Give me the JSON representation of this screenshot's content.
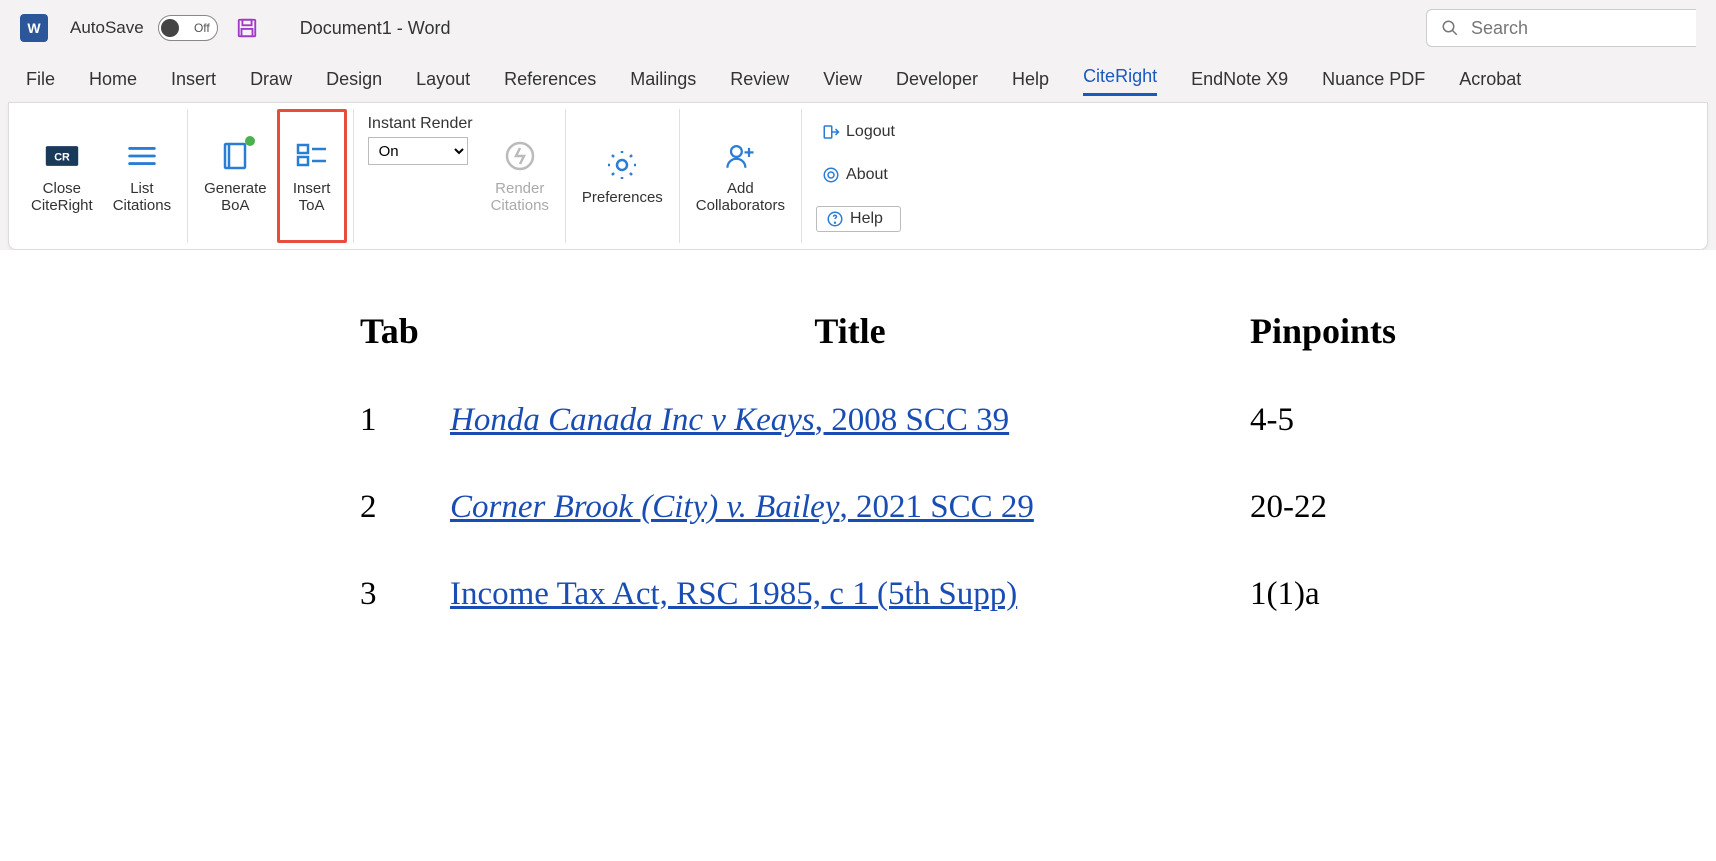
{
  "titlebar": {
    "autosave_label": "AutoSave",
    "autosave_state": "Off",
    "doc_title": "Document1  -  Word",
    "search_placeholder": "Search"
  },
  "menubar": {
    "items": [
      "File",
      "Home",
      "Insert",
      "Draw",
      "Design",
      "Layout",
      "References",
      "Mailings",
      "Review",
      "View",
      "Developer",
      "Help",
      "CiteRight",
      "EndNote X9",
      "Nuance PDF",
      "Acrobat"
    ],
    "active": "CiteRight"
  },
  "ribbon": {
    "close_label_l1": "Close",
    "close_label_l2": "CiteRight",
    "list_label_l1": "List",
    "list_label_l2": "Citations",
    "gen_label_l1": "Generate",
    "gen_label_l2": "BoA",
    "insert_label_l1": "Insert",
    "insert_label_l2": "ToA",
    "instant_label": "Instant Render",
    "instant_value": "On",
    "render_label_l1": "Render",
    "render_label_l2": "Citations",
    "prefs_label": "Preferences",
    "addcollab_l1": "Add",
    "addcollab_l2": "Collaborators",
    "logout": "Logout",
    "about": "About",
    "help": "Help"
  },
  "table": {
    "headers": {
      "tab": "Tab",
      "title": "Title",
      "pinpoints": "Pinpoints"
    },
    "rows": [
      {
        "tab": "1",
        "case": "Honda Canada Inc v Keays",
        "ref": ", 2008 SCC 39",
        "pin": "4-5",
        "italic_case": true
      },
      {
        "tab": "2",
        "case": "Corner Brook (City) v. Bailey",
        "ref": ", 2021 SCC 29",
        "pin": "20-22",
        "italic_case": true
      },
      {
        "tab": "3",
        "case": "Income Tax Act, RSC 1985, c 1 (5th Supp)",
        "ref": "",
        "pin": "1(1)a",
        "italic_case": false
      }
    ]
  }
}
